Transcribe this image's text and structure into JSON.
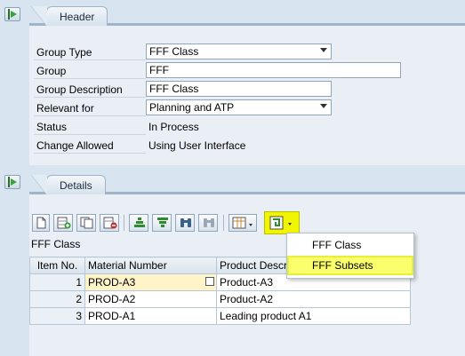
{
  "header_section": {
    "tab_label": "Header",
    "fields": {
      "group_type": {
        "label": "Group Type",
        "value": "FFF Class"
      },
      "group": {
        "label": "Group",
        "value": "FFF"
      },
      "group_description": {
        "label": "Group Description",
        "value": "FFF Class"
      },
      "relevant_for": {
        "label": "Relevant for",
        "value": "Planning and ATP"
      },
      "status": {
        "label": "Status",
        "value": "In Process"
      },
      "change_allowed": {
        "label": "Change Allowed",
        "value": "Using User Interface"
      }
    }
  },
  "details_section": {
    "tab_label": "Details",
    "table_title": "FFF Class",
    "columns": [
      "Item No.",
      "Material Number",
      "Product Descr"
    ],
    "rows": [
      {
        "item_no": "1",
        "material": "PROD-A3",
        "description": "Product-A3"
      },
      {
        "item_no": "2",
        "material": "PROD-A2",
        "description": "Product-A2"
      },
      {
        "item_no": "3",
        "material": "PROD-A1",
        "description": "Leading product A1"
      }
    ],
    "toolbar": {
      "icons": [
        "create-icon",
        "append-row-icon",
        "copy-row-icon",
        "delete-row-icon",
        "sort-ascending-icon",
        "sort-descending-icon",
        "find-icon",
        "find-next-icon",
        "layout-icon",
        "subset-icon"
      ],
      "highlight_color": "#f2f500"
    },
    "menu": {
      "items": [
        {
          "label": "FFF Class",
          "highlighted": false
        },
        {
          "label": "FFF Subsets",
          "highlighted": true
        }
      ]
    }
  }
}
